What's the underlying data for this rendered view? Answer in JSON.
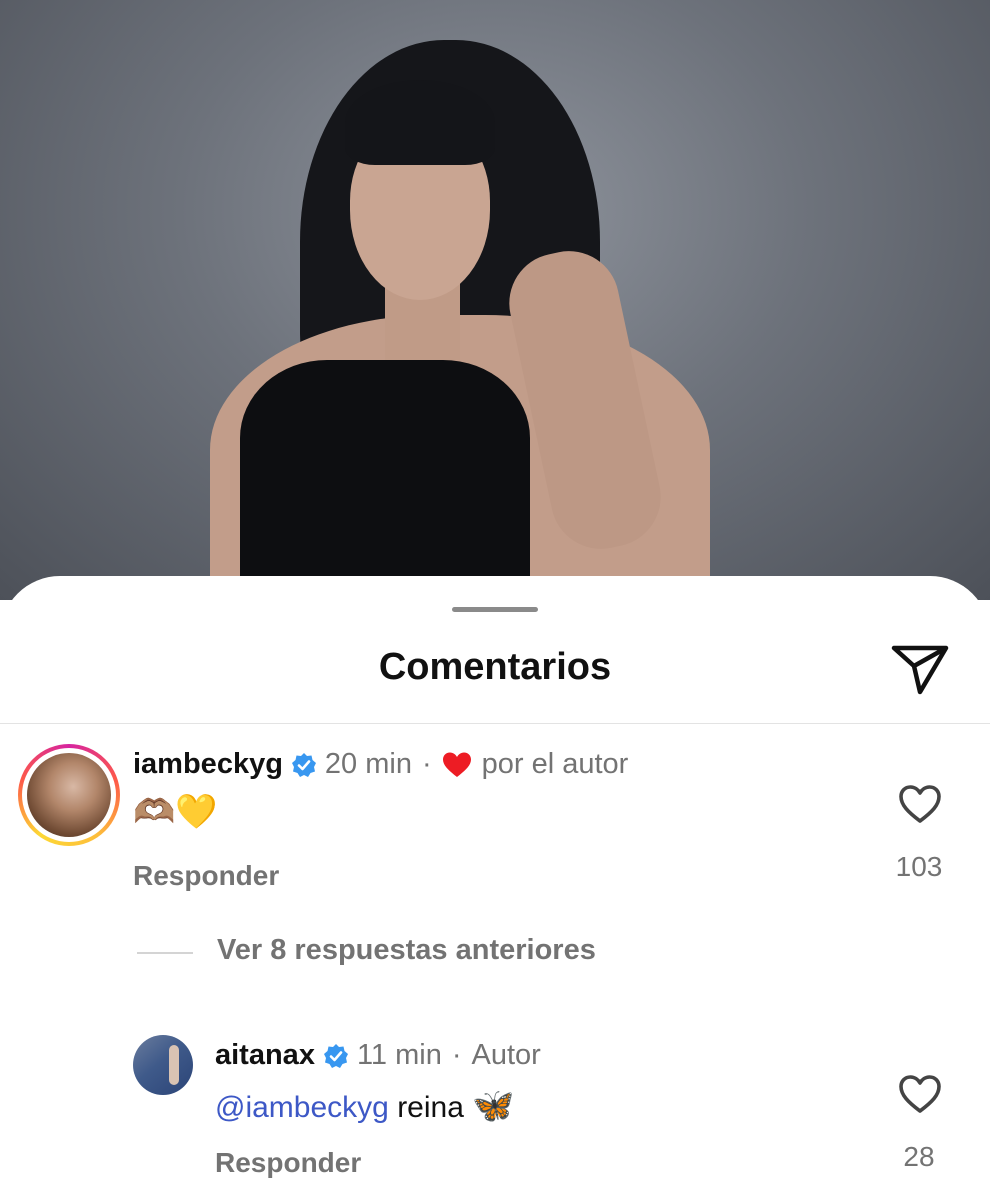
{
  "sheet": {
    "title": "Comentarios"
  },
  "icons": {
    "send": "paper-plane-icon",
    "verified": "verified-badge-icon",
    "heart": "heart-outline-icon",
    "author_heart": "red-heart-icon"
  },
  "colors": {
    "mention": "#3d58c6",
    "muted": "#737373",
    "verified": "#3897f0",
    "author_heart": "#ed1c24"
  },
  "comments": [
    {
      "user": "iambeckyg",
      "verified": true,
      "time": "20 min",
      "separator": "·",
      "liked_by_author": "por el autor",
      "text": "🫶🏽💛",
      "reply_label": "Responder",
      "likes": "103"
    }
  ],
  "replies_toggle": "Ver 8 respuestas anteriores",
  "reply": {
    "user": "aitanax",
    "verified": true,
    "time": "11 min",
    "separator": "·",
    "role": "Autor",
    "mention": "@iambeckyg",
    "text": " reina ",
    "emoji": "🦋",
    "reply_label": "Responder",
    "likes": "28"
  }
}
